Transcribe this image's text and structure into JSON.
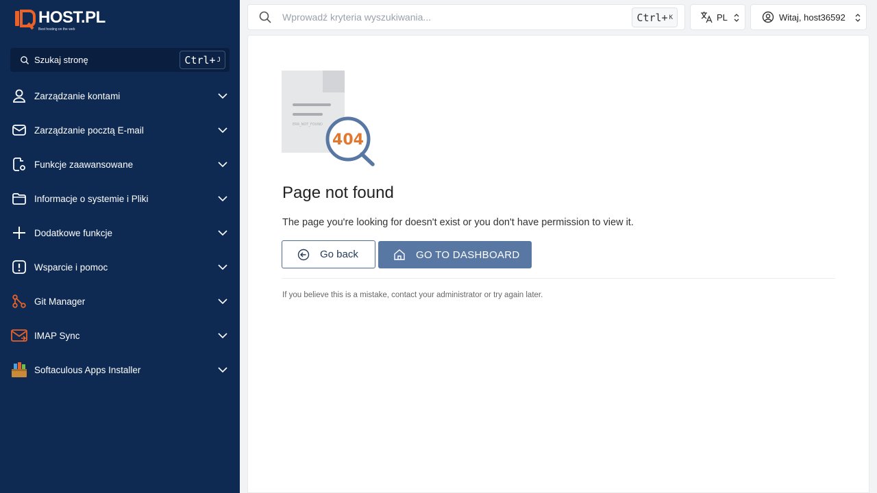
{
  "brand": {
    "name": "HOST.PL",
    "tagline": "Best hosting on the web",
    "accent": "#e8622a"
  },
  "sidebar": {
    "search_label": "Szukaj stronę",
    "search_kbd": "Ctrl+",
    "search_kbd_key": "J",
    "items": [
      {
        "label": "Zarządzanie kontami",
        "icon": "user-icon"
      },
      {
        "label": "Zarządzanie pocztą E-mail",
        "icon": "mail-icon"
      },
      {
        "label": "Funkcje zaawansowane",
        "icon": "advanced-settings-icon"
      },
      {
        "label": "Informacje o systemie i Pliki",
        "icon": "folder-icon"
      },
      {
        "label": "Dodatkowe funkcje",
        "icon": "plus-icon"
      },
      {
        "label": "Wsparcie i pomoc",
        "icon": "alert-icon"
      },
      {
        "label": "Git Manager",
        "icon": "git-icon"
      },
      {
        "label": "IMAP Sync",
        "icon": "imap-mail-icon"
      },
      {
        "label": "Softaculous Apps Installer",
        "icon": "softaculous-icon"
      }
    ]
  },
  "topbar": {
    "search_placeholder": "Wprowadź kryteria wyszukiwania...",
    "search_kbd": "Ctrl+",
    "search_kbd_key": "K",
    "language": "PL",
    "user_greeting": "Witaj, host36592"
  },
  "main": {
    "illustration_code": "404",
    "illustration_doc_text": "ERR_NOT_FOUND",
    "title": "Page not found",
    "description": "The page you're looking for doesn't exist or you don't have permission to view it.",
    "back_label": "Go back",
    "dashboard_label": "GO TO DASHBOARD",
    "note": "If you believe this is a mistake, contact your administrator or try again later."
  }
}
